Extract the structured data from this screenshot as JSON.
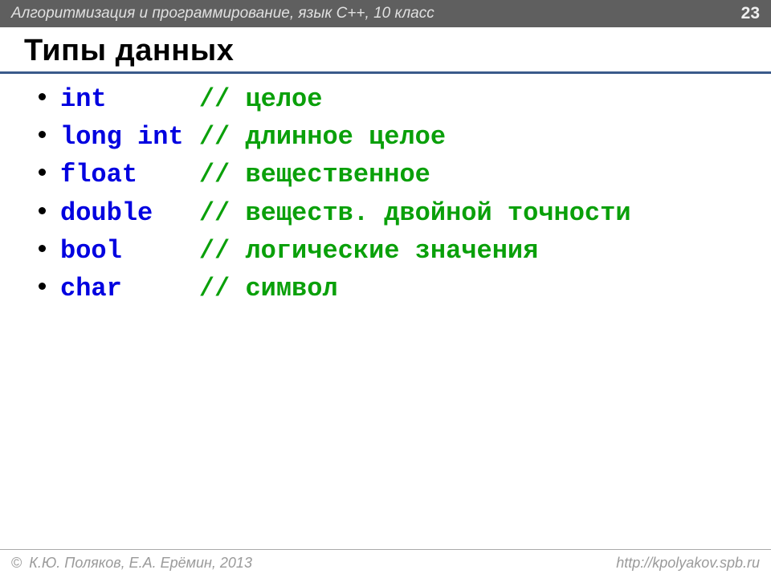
{
  "header": {
    "title": "Алгоритмизация и программирование, язык  C++, 10 класс",
    "page_number": "23"
  },
  "slide": {
    "title": "Типы данных"
  },
  "types": [
    {
      "keyword": "int     ",
      "comment": " // целое"
    },
    {
      "keyword": "long int",
      "comment": " // длинное целое"
    },
    {
      "keyword": "float   ",
      "comment": " // вещественное"
    },
    {
      "keyword": "double  ",
      "comment": " // веществ. двойной точности"
    },
    {
      "keyword": "bool    ",
      "comment": " // логические значения"
    },
    {
      "keyword": "char    ",
      "comment": " // символ"
    }
  ],
  "footer": {
    "copyright_symbol": "©",
    "copyright": " К.Ю. Поляков, Е.А. Ерёмин, 2013",
    "url": "http://kpolyakov.spb.ru"
  }
}
